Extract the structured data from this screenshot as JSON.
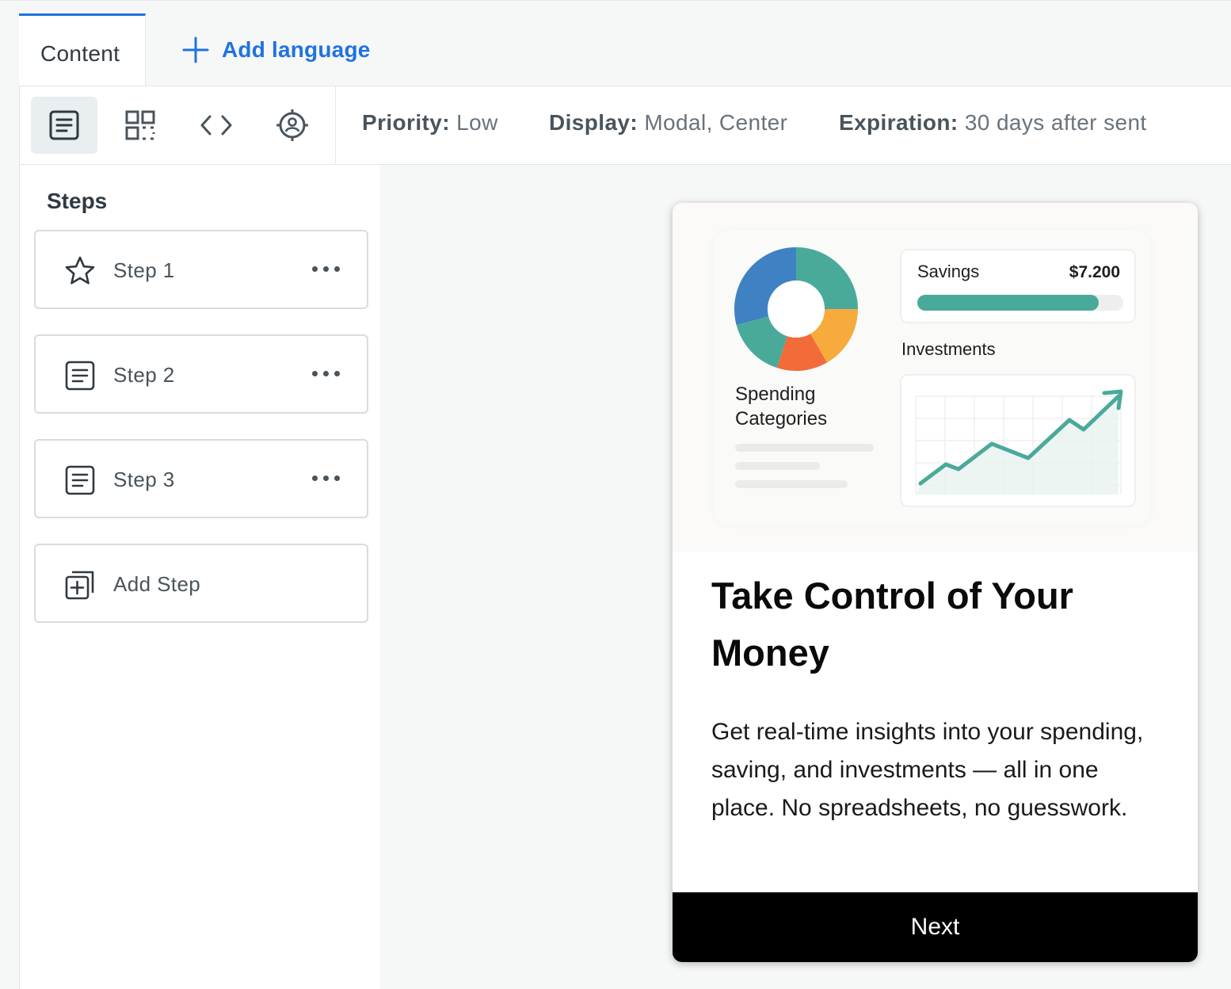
{
  "tabs": {
    "content_label": "Content",
    "add_language_label": "Add language"
  },
  "toolbar": {
    "views": [
      {
        "icon": "document-icon",
        "active": true
      },
      {
        "icon": "qr-code-icon",
        "active": false
      },
      {
        "icon": "code-icon",
        "active": false
      },
      {
        "icon": "target-user-icon",
        "active": false
      }
    ],
    "priority": {
      "label": "Priority:",
      "value": "Low"
    },
    "display": {
      "label": "Display:",
      "value": "Modal, Center"
    },
    "expiration": {
      "label": "Expiration:",
      "value": "30 days after sent"
    }
  },
  "sidebar": {
    "title": "Steps",
    "steps": [
      {
        "label": "Step 1",
        "icon": "star-icon"
      },
      {
        "label": "Step 2",
        "icon": "document-icon"
      },
      {
        "label": "Step 3",
        "icon": "document-icon"
      }
    ],
    "add_step_label": "Add Step"
  },
  "preview": {
    "illustration": {
      "spending_label": "Spending Categories",
      "savings_label": "Savings",
      "savings_value": "$7.200",
      "savings_progress": 0.88,
      "investments_label": "Investments",
      "donut_colors": [
        "#3e82c4",
        "#4aaa9a",
        "#f7ab3c",
        "#f26b38"
      ]
    },
    "title": "Take Control of Your Money",
    "body": "Get real-time insights into your spending, saving, and investments — all in one place. No spreadsheets, no guesswork.",
    "next_label": "Next"
  },
  "colors": {
    "accent": "#1f73e0",
    "text": "#2f3941",
    "muted": "#68737d",
    "button_bg": "#000000"
  }
}
